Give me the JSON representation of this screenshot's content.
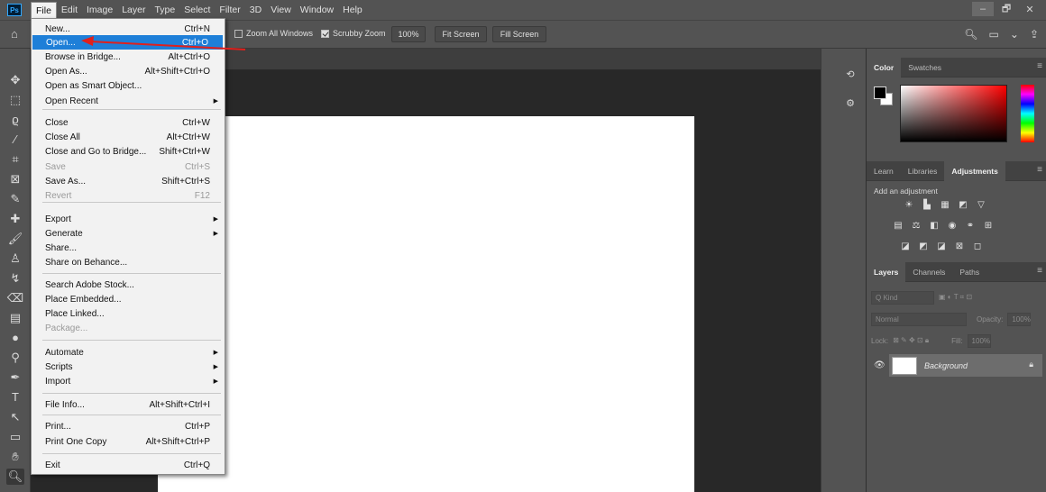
{
  "app": {
    "logo": "Ps"
  },
  "menubar": [
    "File",
    "Edit",
    "Image",
    "Layer",
    "Type",
    "Select",
    "Filter",
    "3D",
    "View",
    "Window",
    "Help"
  ],
  "window_controls": {
    "minimize": "–",
    "restore": "🗗",
    "close": "✕"
  },
  "options": {
    "zoom_all_windows": "Zoom All Windows",
    "scrubby_zoom": "Scrubby Zoom",
    "zoom_100": "100%",
    "fit_screen": "Fit Screen",
    "fill_screen": "Fill Screen"
  },
  "file_menu": {
    "items": [
      {
        "label": "New...",
        "shortcut": "Ctrl+N"
      },
      {
        "label": "Open...",
        "shortcut": "Ctrl+O",
        "highlighted": true
      },
      {
        "label": "Browse in Bridge...",
        "shortcut": "Alt+Ctrl+O"
      },
      {
        "label": "Open As...",
        "shortcut": "Alt+Shift+Ctrl+O"
      },
      {
        "label": "Open as Smart Object...",
        "shortcut": ""
      },
      {
        "label": "Open Recent",
        "shortcut": "",
        "submenu": true
      },
      {
        "label": "Close",
        "shortcut": "Ctrl+W"
      },
      {
        "label": "Close All",
        "shortcut": "Alt+Ctrl+W"
      },
      {
        "label": "Close and Go to Bridge...",
        "shortcut": "Shift+Ctrl+W"
      },
      {
        "label": "Save",
        "shortcut": "Ctrl+S",
        "disabled": true
      },
      {
        "label": "Save As...",
        "shortcut": "Shift+Ctrl+S"
      },
      {
        "label": "Revert",
        "shortcut": "F12",
        "disabled": true
      },
      {
        "label": "Export",
        "shortcut": "",
        "submenu": true
      },
      {
        "label": "Generate",
        "shortcut": "",
        "submenu": true
      },
      {
        "label": "Share...",
        "shortcut": ""
      },
      {
        "label": "Share on Behance...",
        "shortcut": ""
      },
      {
        "label": "Search Adobe Stock...",
        "shortcut": ""
      },
      {
        "label": "Place Embedded...",
        "shortcut": ""
      },
      {
        "label": "Place Linked...",
        "shortcut": ""
      },
      {
        "label": "Package...",
        "shortcut": "",
        "disabled": true
      },
      {
        "label": "Automate",
        "shortcut": "",
        "submenu": true
      },
      {
        "label": "Scripts",
        "shortcut": "",
        "submenu": true
      },
      {
        "label": "Import",
        "shortcut": "",
        "submenu": true
      },
      {
        "label": "File Info...",
        "shortcut": "Alt+Shift+Ctrl+I"
      },
      {
        "label": "Print...",
        "shortcut": "Ctrl+P"
      },
      {
        "label": "Print One Copy",
        "shortcut": "Alt+Shift+Ctrl+P"
      },
      {
        "label": "Exit",
        "shortcut": "Ctrl+Q"
      }
    ]
  },
  "panels": {
    "color_tabs": [
      "Color",
      "Swatches"
    ],
    "adjust_tabs": [
      "Learn",
      "Libraries",
      "Adjustments"
    ],
    "add_adjustment": "Add an adjustment",
    "layers_tabs": [
      "Layers",
      "Channels",
      "Paths"
    ],
    "kind": "Q Kind",
    "blend_mode": "Normal",
    "opacity_label": "Opacity:",
    "opacity_value": "100%",
    "lock_label": "Lock:",
    "fill_label": "Fill:",
    "fill_value": "100%",
    "layer_name": "Background"
  },
  "colors": {
    "highlight": "#1e7fd8",
    "annotation": "#e0201c"
  }
}
